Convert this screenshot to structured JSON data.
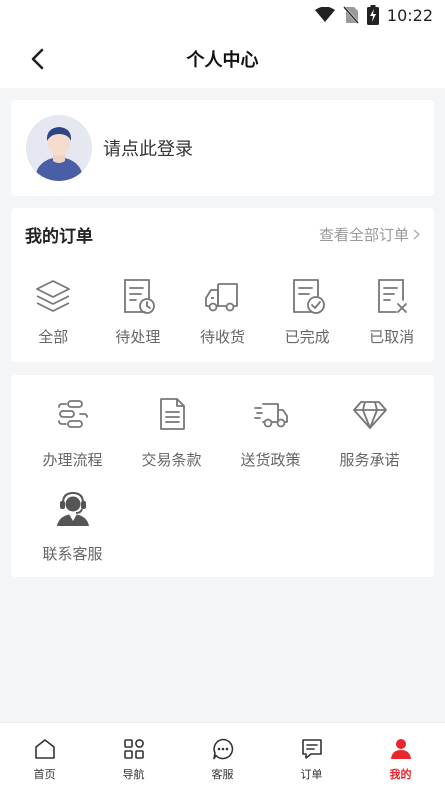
{
  "status_bar": {
    "time": "10:22",
    "icons": [
      "wifi-icon",
      "no-sim-icon",
      "battery-charging-icon"
    ]
  },
  "header": {
    "title": "个人中心",
    "back_icon": "chevron-left-icon"
  },
  "profile": {
    "login_text": "请点此登录",
    "avatar_icon": "user-avatar-icon"
  },
  "orders": {
    "title": "我的订单",
    "view_all": "查看全部订单",
    "view_all_icon": "chevron-right-icon",
    "items": [
      {
        "label": "全部",
        "icon": "layers-icon"
      },
      {
        "label": "待处理",
        "icon": "document-clock-icon"
      },
      {
        "label": "待收货",
        "icon": "truck-icon"
      },
      {
        "label": "已完成",
        "icon": "document-check-icon"
      },
      {
        "label": "已取消",
        "icon": "document-x-icon"
      }
    ]
  },
  "services": {
    "items": [
      {
        "label": "办理流程",
        "icon": "process-flow-icon"
      },
      {
        "label": "交易条款",
        "icon": "document-lines-icon"
      },
      {
        "label": "送货政策",
        "icon": "delivery-truck-icon"
      },
      {
        "label": "服务承诺",
        "icon": "diamond-icon"
      },
      {
        "label": "联系客服",
        "icon": "customer-service-icon"
      }
    ]
  },
  "tab_bar": {
    "active_color": "#e8262d",
    "items": [
      {
        "label": "首页",
        "icon": "home-icon",
        "active": false
      },
      {
        "label": "导航",
        "icon": "grid-icon",
        "active": false
      },
      {
        "label": "客服",
        "icon": "chat-bubble-icon",
        "active": false
      },
      {
        "label": "订单",
        "icon": "order-message-icon",
        "active": false
      },
      {
        "label": "我的",
        "icon": "person-icon",
        "active": true
      }
    ]
  }
}
